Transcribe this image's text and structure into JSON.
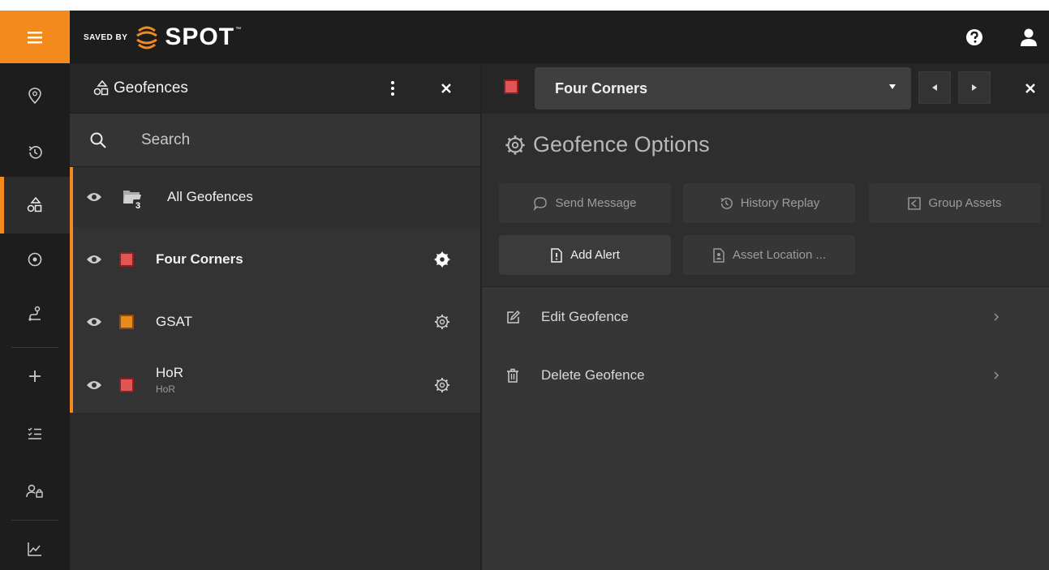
{
  "topbar": {
    "brand_prefix": "SAVED BY",
    "brand_name": "SPOT",
    "brand_tm": "™",
    "accent_color": "#f28a1e",
    "help_icon": "help-circle-icon",
    "user_icon": "user-icon"
  },
  "rail": {
    "items": [
      {
        "icon": "map-pin-icon",
        "active": false
      },
      {
        "icon": "history-icon",
        "active": false
      },
      {
        "icon": "geofence-shapes-icon",
        "active": true
      },
      {
        "icon": "target-icon",
        "active": false
      },
      {
        "icon": "route-icon",
        "active": false
      },
      {
        "icon": "plus-icon",
        "active": false
      },
      {
        "icon": "checklist-icon",
        "active": false
      },
      {
        "icon": "users-lock-icon",
        "active": false
      },
      {
        "icon": "chart-icon",
        "active": false
      }
    ]
  },
  "geofences_panel": {
    "title": "Geofences",
    "search": {
      "placeholder": "Search",
      "value": ""
    },
    "all_item": {
      "label": "All Geofences",
      "count": "3"
    },
    "items": [
      {
        "name": "Four Corners",
        "subtitle": "",
        "color": "#e05555",
        "selected": true
      },
      {
        "name": "GSAT",
        "subtitle": "",
        "color": "#e88a1e",
        "selected": false
      },
      {
        "name": "HoR",
        "subtitle": "HoR",
        "color": "#e05555",
        "selected": false
      }
    ]
  },
  "detail_panel": {
    "selected_name": "Four Corners",
    "selected_color": "#e05555",
    "options_title": "Geofence Options",
    "buttons": [
      {
        "label": "Send Message",
        "icon": "chat-bubble-icon",
        "enabled": false
      },
      {
        "label": "History Replay",
        "icon": "history-icon",
        "enabled": false
      },
      {
        "label": "Group Assets",
        "icon": "share-icon",
        "enabled": false
      },
      {
        "label": "Add Alert",
        "icon": "alert-doc-icon",
        "enabled": true
      },
      {
        "label": "Asset Location ...",
        "icon": "asset-doc-icon",
        "enabled": false
      }
    ],
    "actions": [
      {
        "label": "Edit Geofence",
        "icon": "edit-icon"
      },
      {
        "label": "Delete Geofence",
        "icon": "trash-icon"
      }
    ]
  }
}
